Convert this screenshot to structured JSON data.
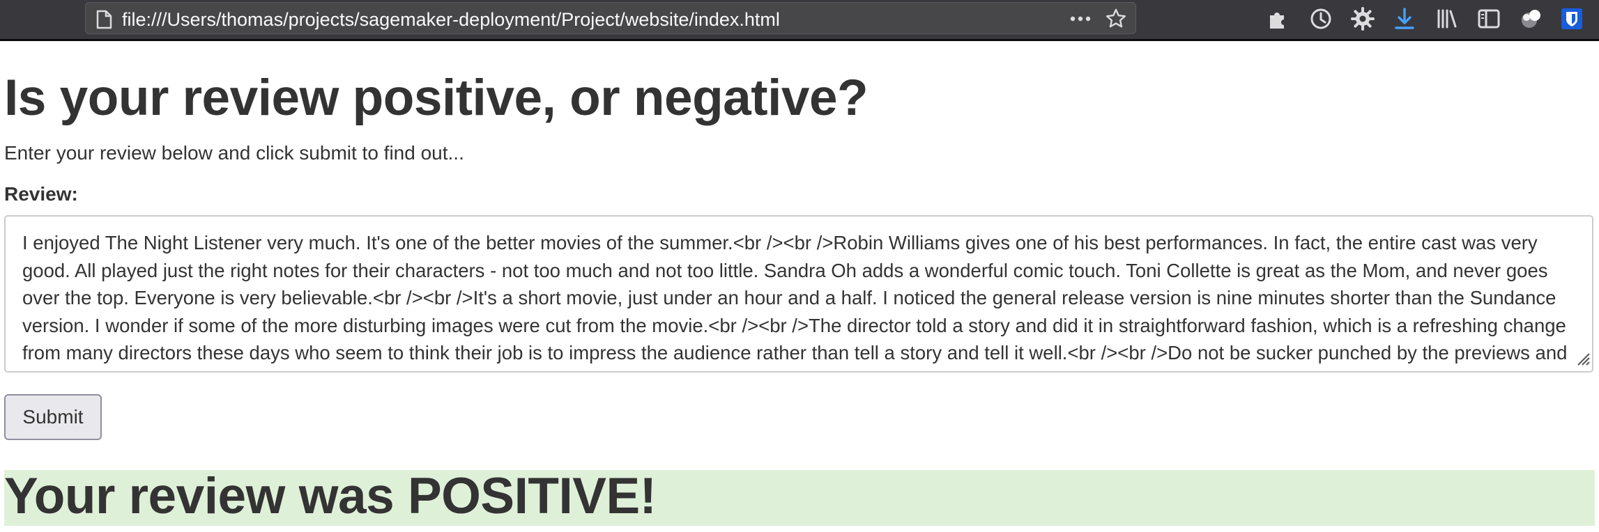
{
  "browser": {
    "url": "file:///Users/thomas/projects/sagemaker-deployment/Project/website/index.html",
    "icons": [
      "page-icon",
      "more-icon",
      "bookmark-star-icon",
      "extensions-icon",
      "history-icon",
      "settings-gear-icon",
      "download-icon",
      "library-icon",
      "sidebar-icon",
      "profile-icon",
      "bitwarden-icon"
    ],
    "colors": {
      "toolbar": "#38383d",
      "urlbar": "#474749",
      "download_accent": "#45a1ff",
      "bitwarden": "#175ddc"
    }
  },
  "page": {
    "title": "Is your review positive, or negative?",
    "intro": "Enter your review below and click submit to find out...",
    "review_label": "Review:",
    "review_text": "I enjoyed The Night Listener very much. It's one of the better movies of the summer.<br /><br />Robin Williams gives one of his best performances. In fact, the entire cast was very good. All played just the right notes for their characters - not too much and not too little. Sandra Oh adds a wonderful comic touch. Toni Collette is great as the Mom, and never goes over the top. Everyone is very believable.<br /><br />It's a short movie, just under an hour and a half. I noticed the general release version is nine minutes shorter than the Sundance version. I wonder if some of the more disturbing images were cut from the movie.<br /><br />The director told a story and did it in straightforward fashion, which is a refreshing change from many directors these days who seem to think their job is to impress the audience rather than tell a story and tell it well.<br /><br />Do not be sucker punched by the previews and ads. It is not a Hitchcock-like thriller. See The Night Listener because you want to see a good story told well. If you go expecting Hitchcock, you will",
    "submit_label": "Submit",
    "result": "Your review was POSITIVE!",
    "result_color": "#dff0d8"
  }
}
